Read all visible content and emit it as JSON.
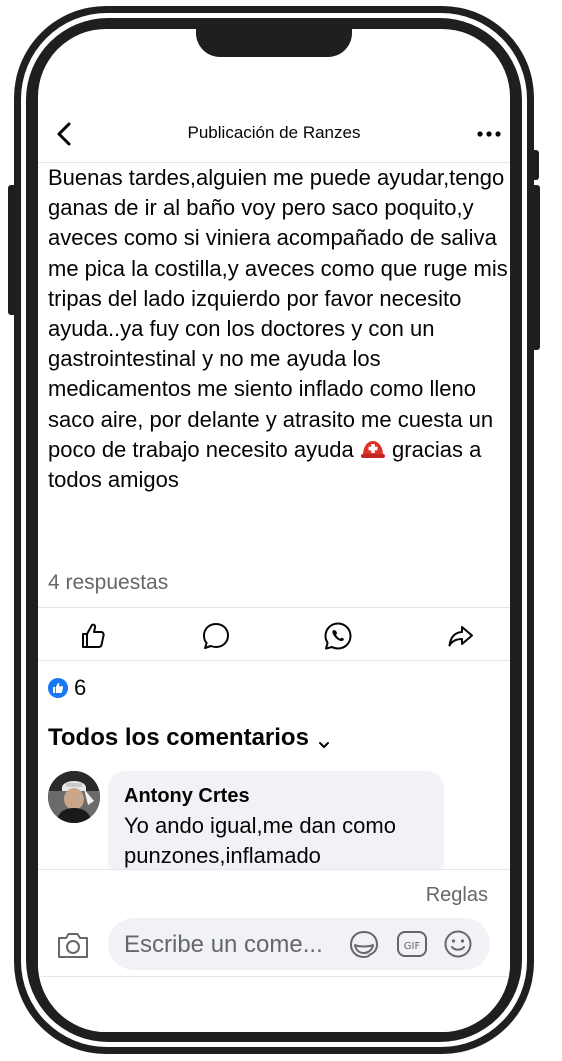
{
  "header": {
    "title": "Publicación de Ranzes",
    "back_icon": "chevron-left-icon",
    "more_icon": "ellipsis-icon"
  },
  "post": {
    "text_before_emoji": "Buenas tardes,alguien me puede ayudar,tengo ganas de ir al baño voy pero saco poquito,y aveces como si viniera acompañado de saliva me pica la costilla,y aveces como que ruge mis tripas del lado izquierdo por favor necesito ayuda..ya fuy con los doctores y con un gastrointestinal y no me ayuda los medicamentos me siento inflado como lleno saco aire, por delante y atrasito me cuesta un poco de trabajo necesito ayuda",
    "text_after_emoji": "gracias a todos amigos",
    "emoji": "rescue-helmet-emoji",
    "reply_count": "4 respuestas"
  },
  "actions": {
    "icons": [
      "like-icon",
      "comment-icon",
      "whatsapp-icon",
      "share-icon"
    ]
  },
  "reactions": {
    "count": "6",
    "icon": "like-badge-icon"
  },
  "comments": {
    "heading": "Todos los comentarios",
    "items": [
      {
        "author": "Antony Crtes",
        "text": "Yo ando igual,me dan como punzones,inflamado"
      }
    ]
  },
  "composer": {
    "rules_label": "Reglas",
    "placeholder": "Escribe un come...",
    "icons": [
      "camera-icon",
      "sticker-icon",
      "gif-icon",
      "emoji-icon"
    ]
  },
  "colors": {
    "accent": "#1877f2",
    "text_primary": "#050505",
    "text_secondary": "#65676b",
    "bubble": "#f0f2f5",
    "frame": "#1f1f1f"
  }
}
